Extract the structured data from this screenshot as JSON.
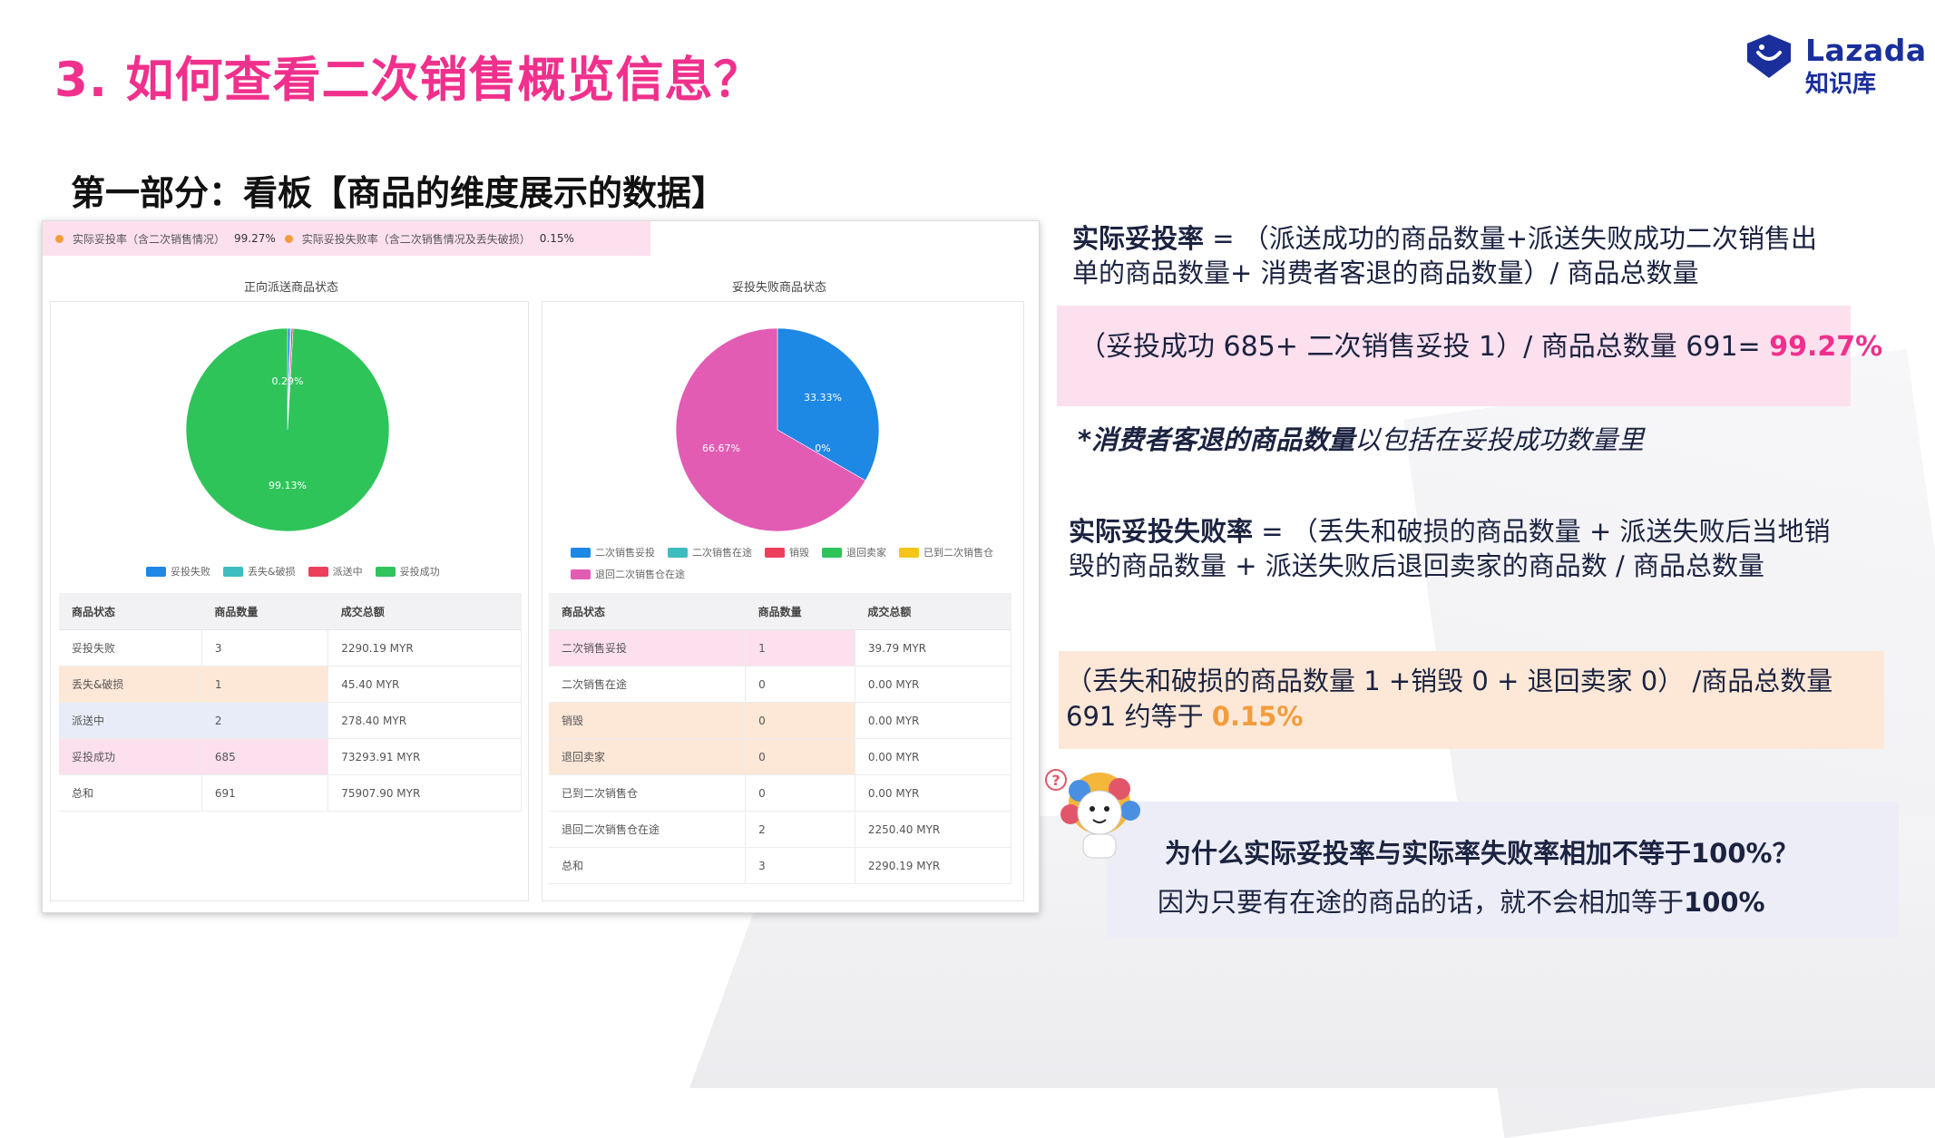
{
  "slide": {
    "title": "3. 如何查看二次销售概览信息？",
    "subtitle": "第一部分：看板【商品的维度展示的数据】"
  },
  "logo": {
    "brand": "Lazada",
    "sub": "知识库",
    "color": "#1a2f9c"
  },
  "dashboard": {
    "metric1_label": "实际妥投率（含二次销售情况）",
    "metric1_value": "99.27%",
    "metric2_label": "实际妥投失败率（含二次销售情况及丢失破损）",
    "metric2_value": "0.15%",
    "left_chart_title": "正向派送商品状态",
    "right_chart_title": "妥投失败商品状态",
    "left_legend": [
      "妥投失败",
      "丢失&破损",
      "派送中",
      "妥投成功"
    ],
    "right_legend": [
      "二次销售妥投",
      "二次销售在途",
      "销毁",
      "退回卖家",
      "已到二次销售仓",
      "退回二次销售仓在途"
    ],
    "table_headers": [
      "商品状态",
      "商品数量",
      "成交总额"
    ],
    "left_table": [
      [
        "妥投失败",
        "3",
        "2290.19 MYR"
      ],
      [
        "丢失&破损",
        "1",
        "45.40 MYR"
      ],
      [
        "派送中",
        "2",
        "278.40 MYR"
      ],
      [
        "妥投成功",
        "685",
        "73293.91 MYR"
      ],
      [
        "总和",
        "691",
        "75907.90 MYR"
      ]
    ],
    "right_table": [
      [
        "二次销售妥投",
        "1",
        "39.79 MYR"
      ],
      [
        "二次销售在途",
        "0",
        "0.00 MYR"
      ],
      [
        "销毁",
        "0",
        "0.00 MYR"
      ],
      [
        "退回卖家",
        "0",
        "0.00 MYR"
      ],
      [
        "已到二次销售仓",
        "0",
        "0.00 MYR"
      ],
      [
        "退回二次销售仓在途",
        "2",
        "2250.40 MYR"
      ],
      [
        "总和",
        "3",
        "2290.19 MYR"
      ]
    ]
  },
  "chart_data": [
    {
      "type": "pie",
      "title": "正向派送商品状态",
      "categories": [
        "妥投失败",
        "丢失&破损",
        "派送中",
        "妥投成功"
      ],
      "values": [
        0.43,
        0.15,
        0.29,
        99.13
      ],
      "data_labels": [
        "0.29%",
        "99.13%"
      ],
      "colors": [
        "#1e88e5",
        "#3ebdc0",
        "#ec3f5c",
        "#2ec45a"
      ],
      "legend": "bottom"
    },
    {
      "type": "pie",
      "title": "妥投失败商品状态",
      "categories": [
        "二次销售妥投",
        "二次销售在途",
        "销毁",
        "退回卖家",
        "已到二次销售仓",
        "退回二次销售仓在途"
      ],
      "values": [
        33.33,
        0,
        0,
        0,
        0,
        66.67
      ],
      "data_labels": [
        "33.33%",
        "0%",
        "66.67%"
      ],
      "colors": [
        "#1e88e5",
        "#3ebdc0",
        "#ec3f5c",
        "#2ec45a",
        "#f5c518",
        "#e25cb4"
      ],
      "legend": "bottom"
    }
  ],
  "right": {
    "formula1_term": "实际妥投率",
    "formula1_rest": " = （派送成功的商品数量+派送失败成功二次销售出单的商品数量+ 消费者客退的商品数量）/ 商品总数量",
    "calc1_text": "（妥投成功 685+ 二次销售妥投 1）/ 商品总数量 691= ",
    "calc1_value": "99.27%",
    "note_bold": "*消费者客退的商品数量",
    "note_rest": "以包括在妥投成功数量里",
    "formula2_term": "实际妥投失败率",
    "formula2_rest": " = （丢失和破损的商品数量 + 派送失败后当地销毁的商品数量 + 派送失败后退回卖家的商品数 / 商品总数量",
    "calc2_text": "（丢失和破损的商品数量 1 +销毁 0 + 退回卖家 0） /商品总数量 691 约等于 ",
    "calc2_value": "0.15%",
    "question": "为什么实际妥投率与实际率失败率相加不等于100%？",
    "answer_text": "因为只要有在途的商品的话，就不会相加等于",
    "answer_bold": "100%"
  }
}
